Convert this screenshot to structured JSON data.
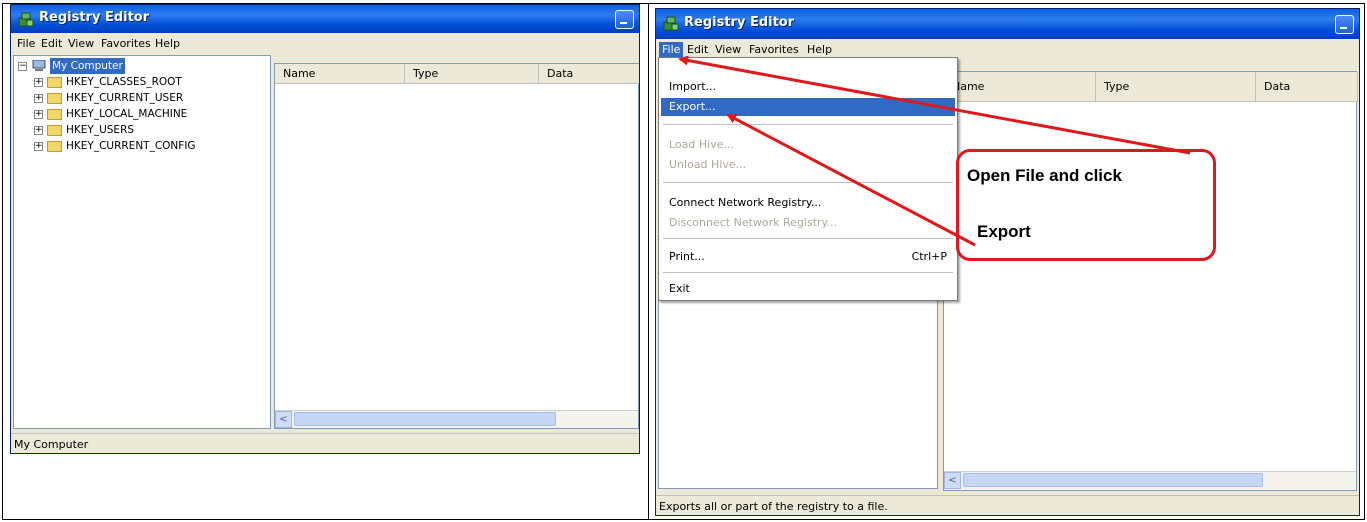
{
  "left_window": {
    "title": "Registry Editor",
    "menu": [
      "File",
      "Edit",
      "View",
      "Favorites",
      "Help"
    ],
    "tree": {
      "root": "My Computer",
      "children": [
        "HKEY_CLASSES_ROOT",
        "HKEY_CURRENT_USER",
        "HKEY_LOCAL_MACHINE",
        "HKEY_USERS",
        "HKEY_CURRENT_CONFIG"
      ]
    },
    "columns": [
      "Name",
      "Type",
      "Data"
    ],
    "status": "My Computer"
  },
  "right_window": {
    "title": "Registry Editor",
    "menu": [
      "File",
      "Edit",
      "View",
      "Favorites",
      "Help"
    ],
    "active_menu": "File",
    "columns": [
      "Name",
      "Type",
      "Data"
    ],
    "file_menu": {
      "import": "Import...",
      "export": "Export...",
      "load_hive": "Load Hive...",
      "unload_hive": "Unload Hive...",
      "connect": "Connect Network Registry...",
      "disconnect": "Disconnect Network Registry...",
      "print": "Print...",
      "print_shortcut": "Ctrl+P",
      "exit": "Exit"
    },
    "status": "Exports all or part of the registry to a file."
  },
  "callout": {
    "line1": "Open File and click",
    "line2": "Export"
  },
  "colors": {
    "titlebar": "#0a5fe0",
    "selection": "#316ac5",
    "callout_border": "#e0181c",
    "annotation_arrow": "#e0181c"
  }
}
